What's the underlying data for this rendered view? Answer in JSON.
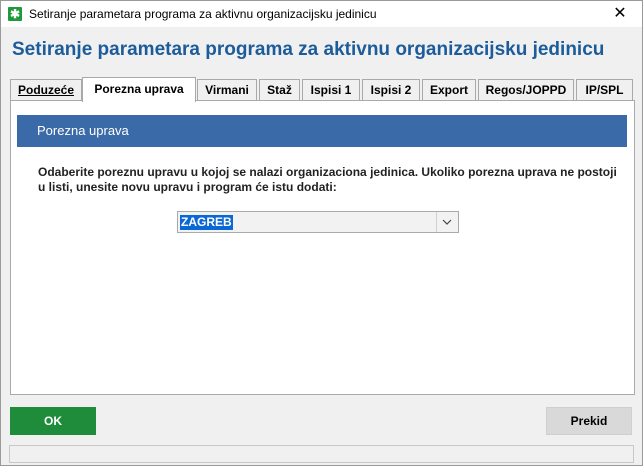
{
  "window": {
    "title": "Setiranje parametara programa za aktivnu organizacijsku jedinicu",
    "close_symbol": "✕",
    "app_icon": "asterisk-icon"
  },
  "heading": "Setiranje parametara programa za aktivnu organizacijsku jedinicu",
  "tabs": [
    {
      "label": "Poduzeće",
      "active": false
    },
    {
      "label": "Porezna uprava",
      "active": true
    },
    {
      "label": "Virmani",
      "active": false
    },
    {
      "label": "Staž",
      "active": false
    },
    {
      "label": "Ispisi 1",
      "active": false
    },
    {
      "label": "Ispisi 2",
      "active": false
    },
    {
      "label": "Export",
      "active": false
    },
    {
      "label": "Regos/JOPPD",
      "active": false
    },
    {
      "label": "IP/SPL",
      "active": false
    }
  ],
  "section": {
    "header": "Porezna uprava",
    "instructions_line1": "Odaberite poreznu upravu u kojoj se nalazi organizaciona jedinica. Ukoliko porezna uprava ne postoji",
    "instructions_line2": "u listi, unesite novu upravu i program će istu dodati:",
    "combo_value": "ZAGREB"
  },
  "buttons": {
    "ok": "OK",
    "cancel": "Prekid"
  },
  "colors": {
    "accent": "#1d5c9a",
    "section_header": "#3b6aa8",
    "ok_green": "#1e8c3b",
    "selection": "#0a67d6"
  }
}
